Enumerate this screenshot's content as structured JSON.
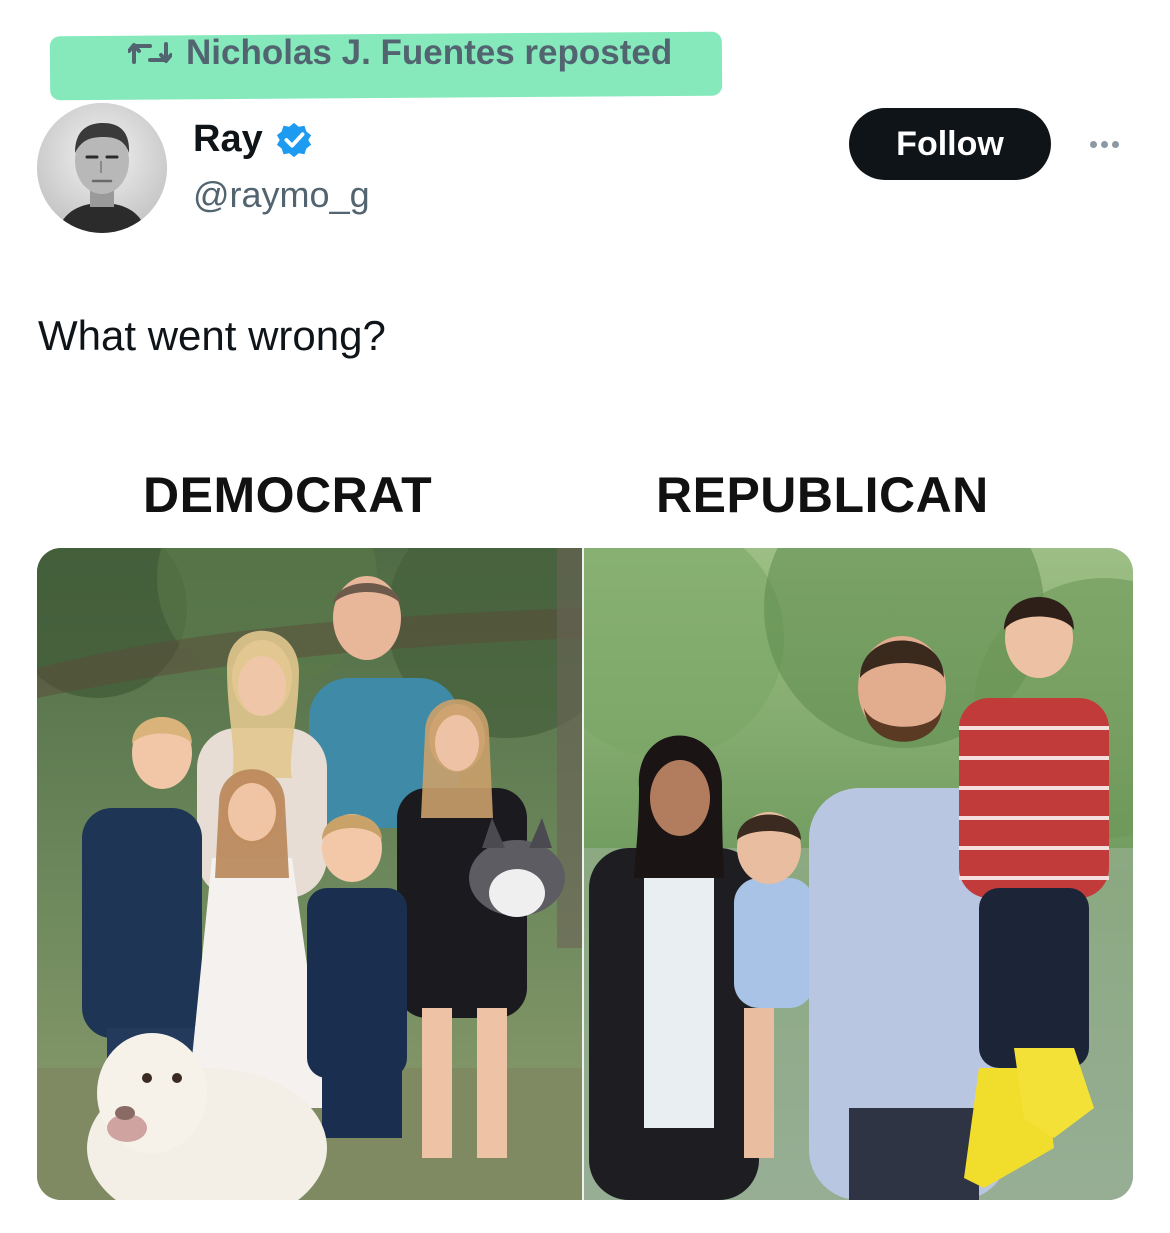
{
  "repost": {
    "text": "Nicholas J. Fuentes reposted",
    "icon": "repost-icon",
    "highlight_color": "#7ee8b7"
  },
  "author": {
    "name": "Ray",
    "handle": "@raymo_g",
    "verified": true,
    "avatar": "portrait-avatar"
  },
  "actions": {
    "follow_label": "Follow",
    "more_icon": "more-icon"
  },
  "tweet": {
    "text": "What went wrong?"
  },
  "media": {
    "left_label": "DEMOCRAT",
    "right_label": "REPUBLICAN",
    "left_image": "family-photo-democrat",
    "right_image": "family-photo-republican"
  },
  "colors": {
    "verified_blue": "#1d9bf0",
    "button_black": "#0f1419",
    "secondary_text": "#536471"
  }
}
